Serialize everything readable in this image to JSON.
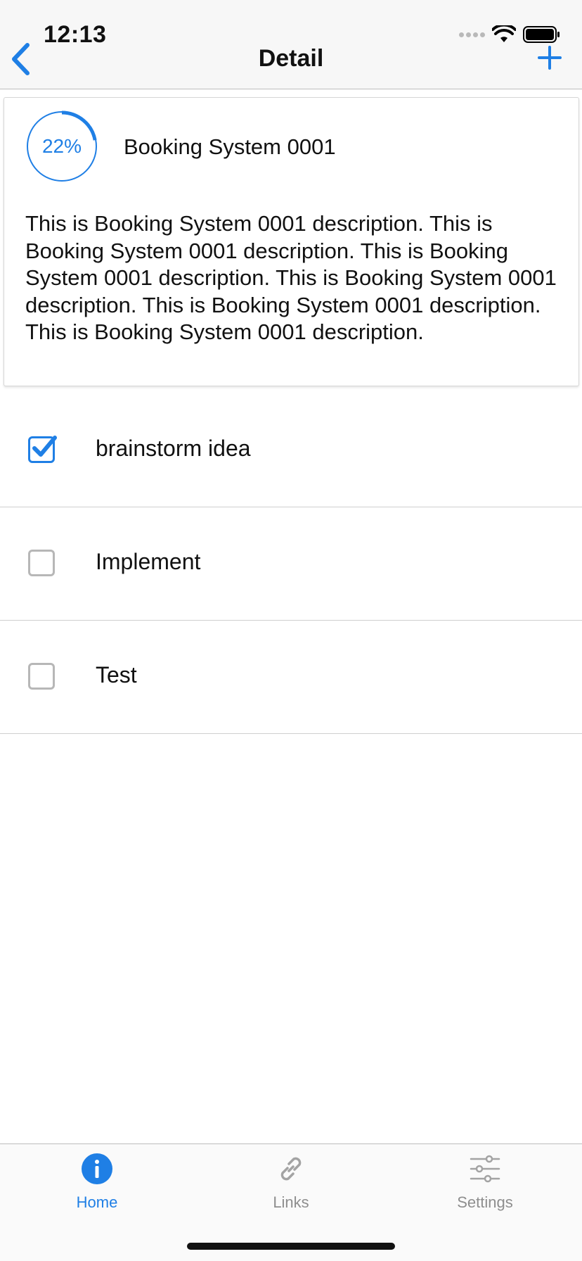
{
  "status_bar": {
    "time": "12:13"
  },
  "nav": {
    "title": "Detail",
    "back_icon": "chevron-left-icon",
    "add_icon": "plus-icon"
  },
  "project": {
    "progress_percent": 22,
    "progress_label": "22%",
    "title": "Booking System 0001",
    "description": "This is Booking System 0001 description. This is Booking System 0001 description. This is Booking System 0001 description. This is Booking System 0001 description. This is Booking System 0001 description. This is Booking System 0001 description."
  },
  "tasks": [
    {
      "label": "brainstorm idea",
      "checked": true
    },
    {
      "label": "Implement",
      "checked": false
    },
    {
      "label": "Test",
      "checked": false
    }
  ],
  "tabs": [
    {
      "label": "Home",
      "icon": "info-icon",
      "active": true
    },
    {
      "label": "Links",
      "icon": "link-icon",
      "active": false
    },
    {
      "label": "Settings",
      "icon": "sliders-icon",
      "active": false
    }
  ],
  "colors": {
    "accent": "#1f7fe5",
    "inactive": "#8e8e8e",
    "checkbox_border": "#b7b7b7"
  }
}
